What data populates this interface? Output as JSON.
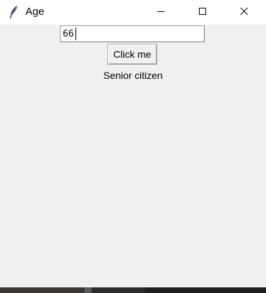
{
  "window": {
    "title": "Age",
    "icon": "feather-icon"
  },
  "controls": {
    "minimize_icon": "minimize-icon",
    "maximize_icon": "maximize-icon",
    "close_icon": "close-icon"
  },
  "form": {
    "age_value": "66",
    "button_label": "Click me",
    "result_text": "Senior citizen"
  },
  "colors": {
    "window_bg": "#f0f0f0",
    "titlebar_bg": "#ffffff"
  }
}
